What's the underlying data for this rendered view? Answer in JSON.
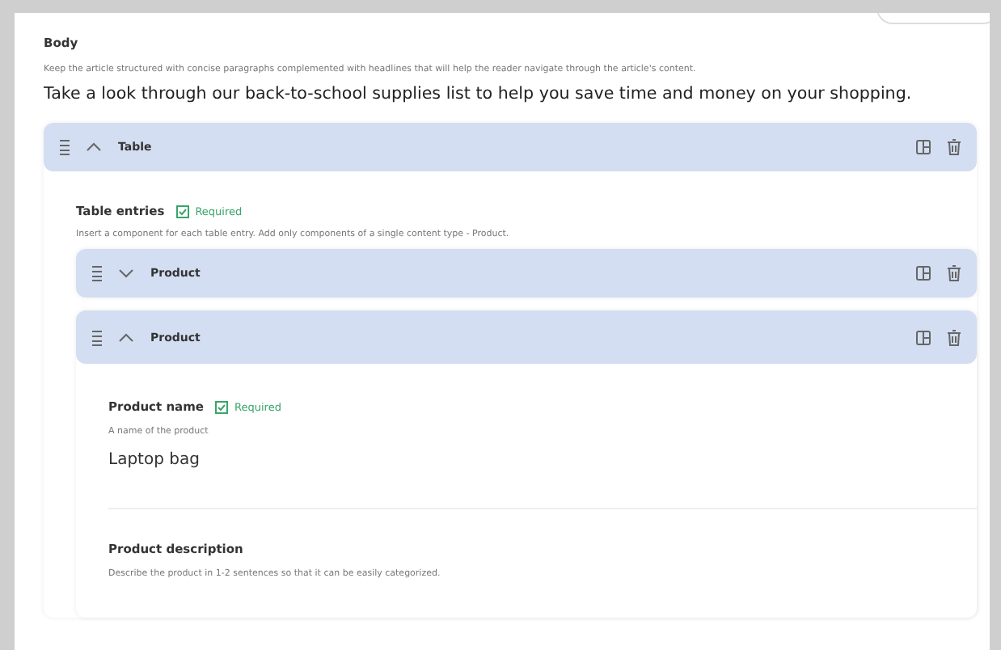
{
  "body": {
    "label": "Body",
    "description": "Keep the article structured with concise paragraphs complemented with headlines that will help the reader navigate through the article's content.",
    "value": "Take a look through our back-to-school supplies list to help you save time and money on your shopping."
  },
  "table": {
    "title": "Table",
    "expanded": true,
    "entries": {
      "label": "Table entries",
      "required": true,
      "required_label": "Required",
      "description": "Insert a component for each table entry. Add only components of a single content type - Product."
    },
    "products": [
      {
        "title": "Product",
        "expanded": false
      },
      {
        "title": "Product",
        "expanded": true,
        "fields": [
          {
            "label": "Product name",
            "required": true,
            "required_label": "Required",
            "hint": "A name of the product",
            "value": "Laptop bag"
          },
          {
            "label": "Product description",
            "required": false,
            "hint": "Describe the product in 1-2 sentences so that it can be easily categorized."
          }
        ]
      }
    ]
  }
}
